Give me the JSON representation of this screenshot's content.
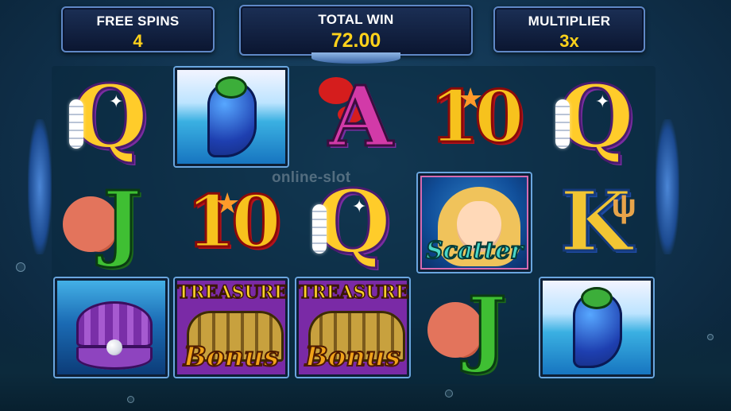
{
  "header": {
    "free_spins": {
      "label": "FREE SPINS",
      "value": "4"
    },
    "total_win": {
      "label": "TOTAL WIN",
      "value": "72.00"
    },
    "multiplier": {
      "label": "MULTIPLIER",
      "value": "3x"
    }
  },
  "watermark": "online-slot",
  "reels": [
    [
      "Q",
      "J",
      "clam-icon"
    ],
    [
      "seahorse-icon",
      "10",
      "bonus"
    ],
    [
      "A",
      "Q",
      "bonus"
    ],
    [
      "10",
      "scatter",
      "J"
    ],
    [
      "Q",
      "K",
      "seahorse-icon"
    ]
  ],
  "symbols": {
    "q": "Q",
    "a": "A",
    "ten": "10",
    "j": "J",
    "k": "K",
    "scatter": "Scatter",
    "treasure": "TREASURE",
    "bonus": "Bonus"
  },
  "colors": {
    "panel_border": "#5f88c6",
    "value_gold": "#ffd21a",
    "background": "#123653"
  }
}
